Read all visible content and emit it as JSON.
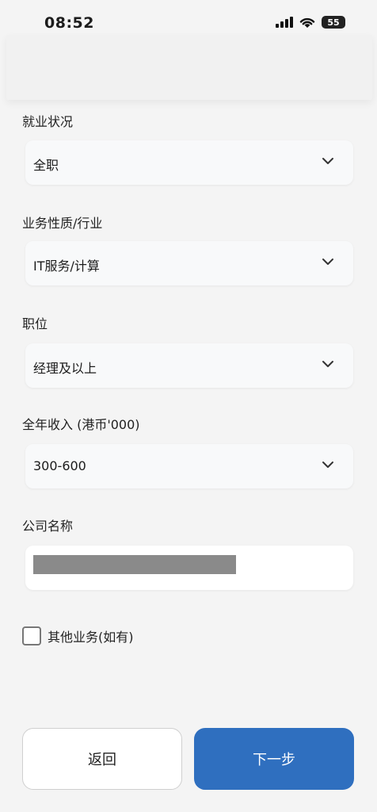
{
  "status_bar": {
    "time": "08:52",
    "battery": "55"
  },
  "fields": [
    {
      "label": "就业状况",
      "value": "全职"
    },
    {
      "label": "业务性质/行业",
      "value": "IT服务/计算"
    },
    {
      "label": "职位",
      "value": "经理及以上"
    },
    {
      "label": "全年收入 (港币'000)",
      "value": "300-600"
    }
  ],
  "company": {
    "label": "公司名称"
  },
  "other_business": {
    "label": "其他业务(如有)",
    "checked": false
  },
  "buttons": {
    "back": "返回",
    "next": "下一步"
  },
  "colors": {
    "primary": "#2f6fbf",
    "background": "#f4f4f4"
  }
}
